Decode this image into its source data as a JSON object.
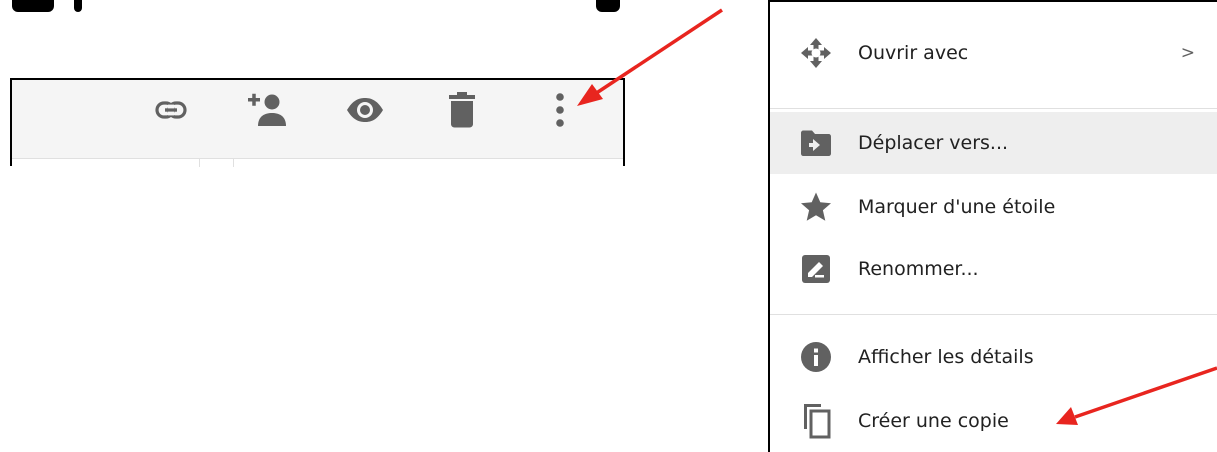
{
  "toolbar": {
    "icons": [
      {
        "name": "link-icon"
      },
      {
        "name": "add-person-icon"
      },
      {
        "name": "eye-icon"
      },
      {
        "name": "trash-icon"
      },
      {
        "name": "more-vert-icon"
      }
    ],
    "icon_color": "#616161"
  },
  "menu": {
    "items": [
      {
        "label": "Ouvrir avec",
        "icon": "move-arrows-icon",
        "submenu": ">"
      },
      {
        "label": "Déplacer vers...",
        "icon": "folder-move-icon",
        "highlighted": true
      },
      {
        "label": "Marquer d'une étoile",
        "icon": "star-icon"
      },
      {
        "label": "Renommer...",
        "icon": "edit-icon"
      },
      {
        "label": "Afficher les détails",
        "icon": "info-icon"
      },
      {
        "label": "Créer une copie",
        "icon": "copy-icon"
      }
    ],
    "highlight_color": "#eeeeee",
    "icon_color": "#616161"
  },
  "annotations": {
    "arrow_color": "#e8251f"
  }
}
